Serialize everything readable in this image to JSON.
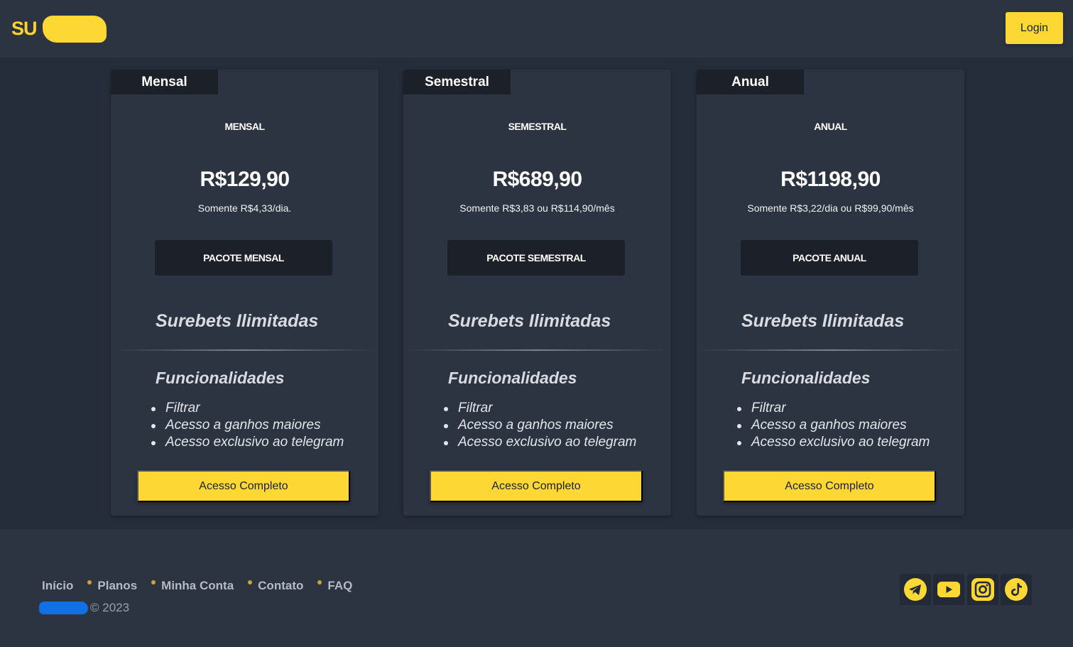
{
  "header": {
    "logo_text": "SU",
    "login_label": "Login"
  },
  "plans": [
    {
      "tab": "Mensal",
      "kicker": "MENSAL",
      "price": "R$129,90",
      "subtitle": "Somente R$4,33/dia.",
      "package_label": "PACOTE MENSAL",
      "headline": "Surebets Ilimitadas",
      "features_title": "Funcionalidades",
      "features": [
        "Filtrar",
        "Acesso a ganhos maiores",
        "Acesso exclusivo ao telegram"
      ],
      "cta": "Acesso Completo"
    },
    {
      "tab": "Semestral",
      "kicker": "SEMESTRAL",
      "price": "R$689,90",
      "subtitle": "Somente R$3,83 ou R$114,90/mês",
      "package_label": "PACOTE SEMESTRAL",
      "headline": "Surebets Ilimitadas",
      "features_title": "Funcionalidades",
      "features": [
        "Filtrar",
        "Acesso a ganhos maiores",
        "Acesso exclusivo ao telegram"
      ],
      "cta": "Acesso Completo"
    },
    {
      "tab": "Anual",
      "kicker": "ANUAL",
      "price": "R$1198,90",
      "subtitle": "Somente R$3,22/dia ou R$99,90/mês",
      "package_label": "PACOTE ANUAL",
      "headline": "Surebets Ilimitadas",
      "features_title": "Funcionalidades",
      "features": [
        "Filtrar",
        "Acesso a ganhos maiores",
        "Acesso exclusivo ao telegram"
      ],
      "cta": "Acesso Completo"
    }
  ],
  "footer": {
    "nav": [
      "Início",
      "Planos",
      "Minha Conta",
      "Contato",
      "FAQ"
    ],
    "copyright": "© 2023",
    "social_icons": [
      "telegram-icon",
      "youtube-icon",
      "instagram-icon",
      "tiktok-icon"
    ]
  },
  "colors": {
    "accent": "#fdd835",
    "background": "#262d3a",
    "surface": "#2c3341",
    "dark_tab": "#1c2029",
    "brand_redaction": "#1170e4"
  }
}
